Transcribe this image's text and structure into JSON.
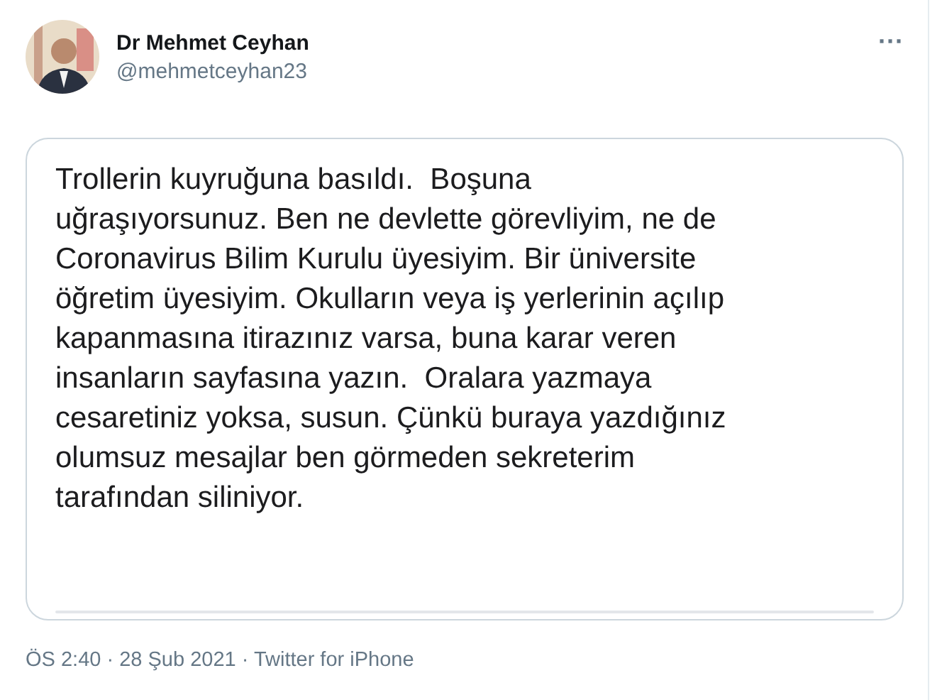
{
  "author": {
    "name": "Dr Mehmet Ceyhan",
    "handle": "@mehmetceyhan23"
  },
  "more_label": "···",
  "media": {
    "kind": "text_image",
    "lines": [
      "Trollerin kuyruğuna basıldı.  Boşuna",
      "uğraşıyorsunuz. Ben ne devlette görevliyim, ne de",
      "Coronavirus Bilim Kurulu üyesiyim. Bir üniversite",
      "öğretim üyesiyim. Okulların veya iş yerlerinin açılıp",
      "kapanmasına itirazınız varsa, buna karar veren",
      "insanların sayfasına yazın.  Oralara yazmaya",
      "cesaretiniz yoksa, susun. Çünkü buraya yazdığınız",
      "olumsuz mesajlar ben görmeden sekreterim",
      "tarafından siliniyor."
    ]
  },
  "meta": "ÖS 2:40 · 28 Şub 2021 · Twitter for iPhone"
}
